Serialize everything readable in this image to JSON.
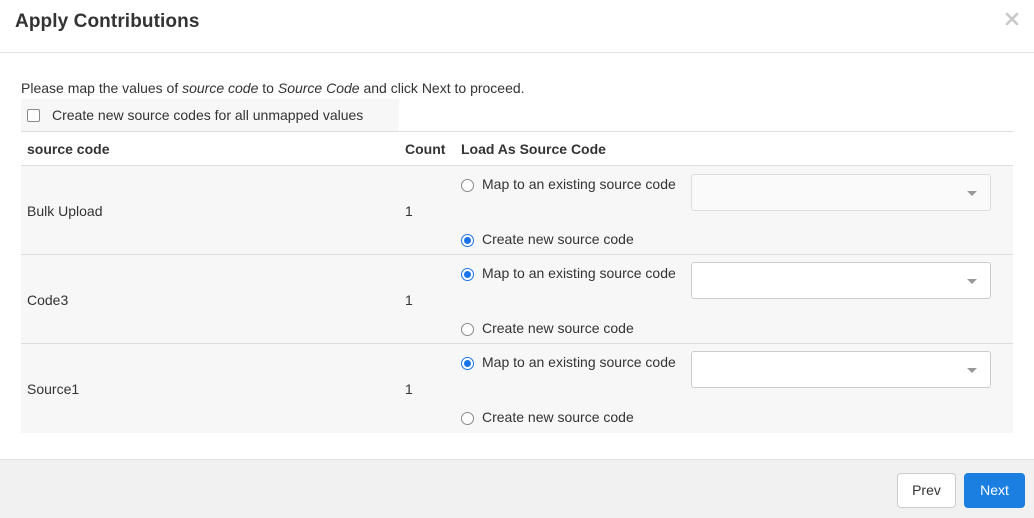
{
  "dialog": {
    "title": "Apply Contributions",
    "close_icon": "close-icon"
  },
  "intro": {
    "prefix": "Please map the values of ",
    "source_field": "source code",
    "middle": " to ",
    "target_field": "Source Code",
    "suffix": " and click Next to proceed."
  },
  "bulk_option": {
    "label": "Create new source codes for all unmapped values",
    "checked": false
  },
  "table": {
    "headers": {
      "source_code": "source code",
      "count": "Count",
      "load_as": "Load As Source Code"
    },
    "rows": [
      {
        "code": "Bulk Upload",
        "count": "1",
        "map_label": "Map to an existing source code",
        "create_label": "Create new source code",
        "selected": "create",
        "select_value": ""
      },
      {
        "code": "Code3",
        "count": "1",
        "map_label": "Map to an existing source code",
        "create_label": "Create new source code",
        "selected": "map",
        "select_value": ""
      },
      {
        "code": "Source1",
        "count": "1",
        "map_label": "Map to an existing source code",
        "create_label": "Create new source code",
        "selected": "map",
        "select_value": ""
      }
    ]
  },
  "footer": {
    "prev_label": "Prev",
    "next_label": "Next"
  },
  "colors": {
    "accent": "#1a7fe0",
    "row_bg": "#f7f7f7",
    "footer_bg": "#f1f1f1"
  }
}
